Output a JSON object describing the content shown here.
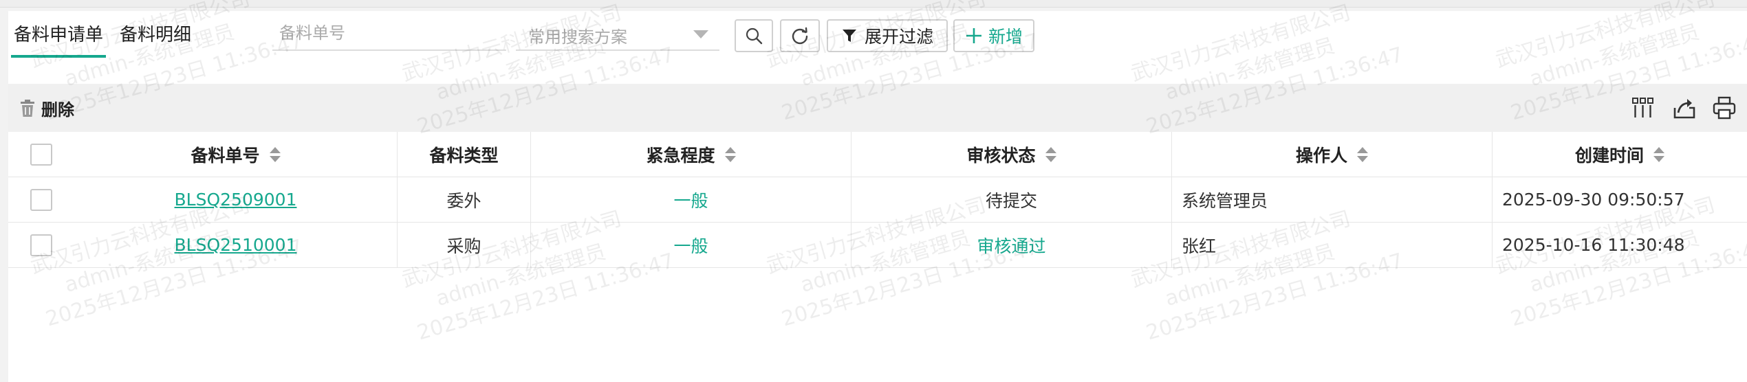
{
  "tabs": [
    {
      "label": "备料申请单",
      "active": true
    },
    {
      "label": "备料明细",
      "active": false
    }
  ],
  "search": {
    "placeholder": "备料单号",
    "scheme_placeholder": "常用搜索方案"
  },
  "toolbar": {
    "filter_label": "展开过滤",
    "add_label": "新增"
  },
  "actions": {
    "delete_label": "删除"
  },
  "table": {
    "headers": [
      "备料单号",
      "备料类型",
      "紧急程度",
      "审核状态",
      "操作人",
      "创建时间"
    ],
    "rows": [
      {
        "no": "BLSQ2509001",
        "type": "委外",
        "urgency": "一般",
        "status": "待提交",
        "operator": "系统管理员",
        "created": "2025-09-30 09:50:57"
      },
      {
        "no": "BLSQ2510001",
        "type": "采购",
        "urgency": "一般",
        "status": "审核通过",
        "operator": "张红",
        "created": "2025-10-16 11:30:48"
      }
    ]
  },
  "watermark": {
    "company": "武汉引力云科技有限公司",
    "user": "admin-系统管理员",
    "time": "2025年12月23日 11:36:47"
  },
  "colors": {
    "accent": "#16a88e",
    "toolbar_bg": "#f0f0f0"
  },
  "icons": [
    "search-icon",
    "refresh-icon",
    "filter-icon",
    "plus-icon",
    "trash-icon",
    "columns-icon",
    "export-icon",
    "print-icon",
    "sort-icon"
  ]
}
